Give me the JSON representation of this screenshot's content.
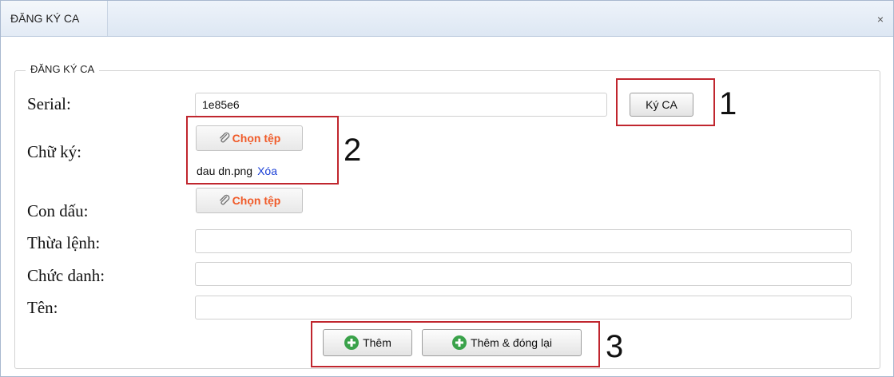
{
  "dialog": {
    "title": "ĐĂNG KÝ CA",
    "close_symbol": "×"
  },
  "form": {
    "legend": "ĐĂNG KÝ CA",
    "serial": {
      "label": "Serial:",
      "value": "1e85e6",
      "sign_button": "Ký CA"
    },
    "signature": {
      "label": "Chữ ký:",
      "choose_file": "Chọn tệp",
      "file_name": "dau dn.png",
      "delete_link": "Xóa"
    },
    "stamp": {
      "label": "Con dấu:",
      "choose_file": "Chọn tệp"
    },
    "on_behalf": {
      "label": "Thừa lệnh:",
      "value": ""
    },
    "position": {
      "label": "Chức danh:",
      "value": ""
    },
    "name": {
      "label": "Tên:",
      "value": ""
    }
  },
  "actions": {
    "add": "Thêm",
    "add_and_close": "Thêm & đóng lại"
  },
  "annotations": {
    "box1": "1",
    "box2": "2",
    "box3": "3"
  },
  "colors": {
    "annotation_red": "#c0262e",
    "file_button_text": "#f05a28",
    "link_blue": "#1a3fd6",
    "plus_icon_green": "#3aa24a"
  },
  "icons": {
    "file_button": "paperclip-icon",
    "add_button": "plus-circle-icon",
    "close": "close-icon"
  }
}
